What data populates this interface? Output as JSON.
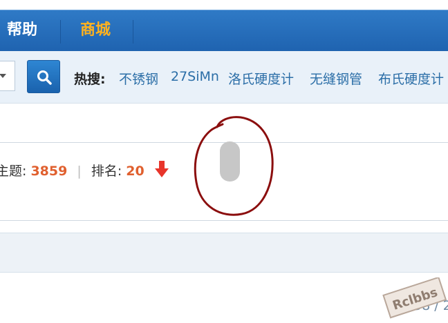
{
  "nav": {
    "help_label": "帮助",
    "mall_label": "商城"
  },
  "search": {
    "hot_label": "热搜:",
    "hot_terms": [
      "不锈钢",
      "27SiMn",
      "洛氏硬度计",
      "无缝钢管",
      "布氏硬度计"
    ]
  },
  "stats": {
    "topics_label": "主题:",
    "topics_value": "3859",
    "rank_label": "排名:",
    "rank_value": "20",
    "divider": "|"
  },
  "pagination": {
    "text": "58 / 2"
  },
  "watermark": {
    "text": "Rclbbs"
  },
  "colors": {
    "nav_bg": "#2a72bf",
    "mall_accent": "#ffb21f",
    "link": "#2b6ea7",
    "stat_number": "#e0602f",
    "annotation": "#8b0e0e"
  }
}
